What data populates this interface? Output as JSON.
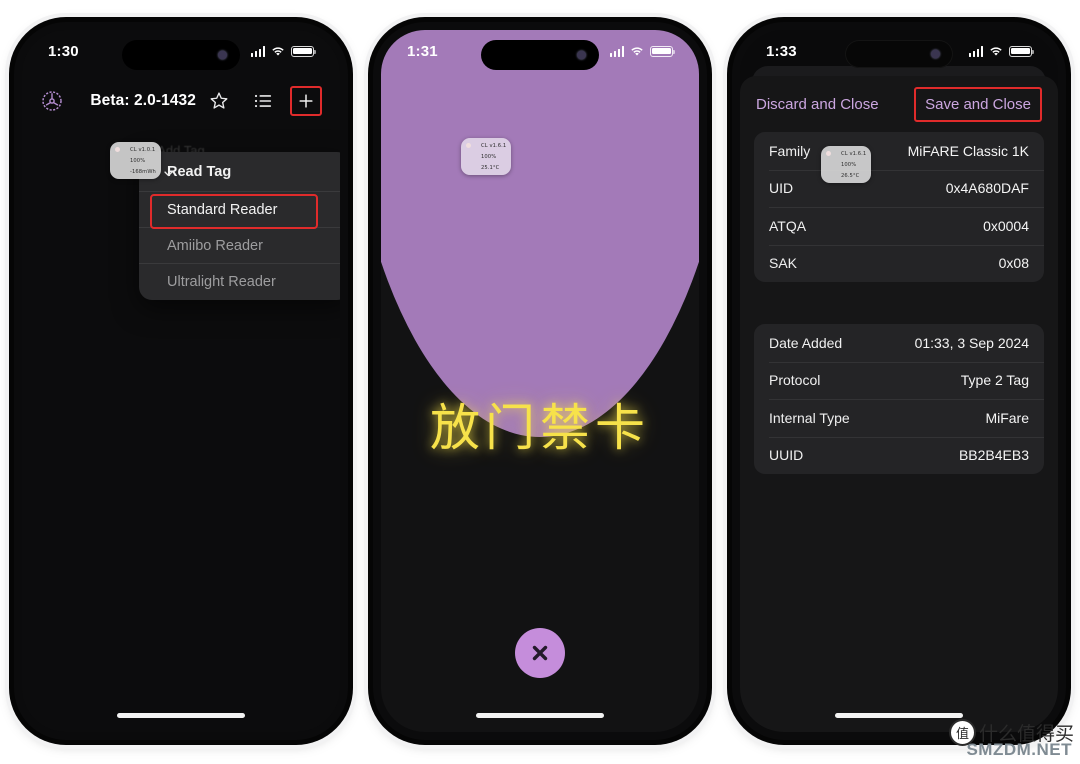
{
  "page": {
    "background": "#ffffff",
    "watermark": {
      "mark": "值",
      "brand": "什么值得买",
      "site": "SMZDM.NET"
    }
  },
  "phones": [
    {
      "id": "phone-read-tag-menu",
      "status": {
        "time": "1:30",
        "cellular": "signal-icon",
        "wifi": "wifi-icon",
        "battery": "battery-icon"
      },
      "toolbar": {
        "settings_icon": "gear-icon",
        "title": "Beta: 2.0-1432",
        "star_icon": "star-icon",
        "list_icon": "list-icon",
        "add_icon": "plus-icon",
        "add_highlighted": true
      },
      "ghost_label": "Add Tag",
      "menu": {
        "header": "Read Tag",
        "items": [
          {
            "label": "Standard Reader",
            "selected": true
          },
          {
            "label": "Amiibo Reader",
            "selected": false
          },
          {
            "label": "Ultralight Reader",
            "selected": false
          }
        ]
      },
      "widget": {
        "version": "CL v1.0.1",
        "battery": "100%",
        "third": "-168mWh",
        "third_glyph": "power-icon"
      }
    },
    {
      "id": "phone-nfc-scan",
      "status": {
        "time": "1:31",
        "cellular": "signal-icon",
        "wifi": "wifi-icon",
        "battery": "battery-icon"
      },
      "dome_color": "#a37ab8",
      "prompt": "放门禁卡",
      "prompt_color": "#f7e24a",
      "close_label": "close-icon",
      "widget": {
        "version": "CL v1.6.1",
        "battery": "100%",
        "third": "25.1°C",
        "third_glyph": "thermometer-icon"
      }
    },
    {
      "id": "phone-tag-details",
      "status": {
        "time": "1:33",
        "cellular": "signal-icon",
        "wifi": "wifi-icon",
        "battery": "battery-icon"
      },
      "actions": {
        "discard": "Discard and Close",
        "save": "Save and Close",
        "save_highlighted": true
      },
      "widget": {
        "version": "CL v1.6.1",
        "battery": "100%",
        "third": "26.5°C",
        "third_glyph": "thermometer-icon"
      },
      "groups": [
        {
          "rows": [
            {
              "key": "Family",
              "value": "MiFARE Classic 1K"
            },
            {
              "key": "UID",
              "value": "0x4A680DAF"
            },
            {
              "key": "ATQA",
              "value": "0x0004"
            },
            {
              "key": "SAK",
              "value": "0x08"
            }
          ]
        },
        {
          "rows": [
            {
              "key": "Date Added",
              "value": "01:33, 3 Sep 2024"
            },
            {
              "key": "Protocol",
              "value": "Type 2 Tag"
            },
            {
              "key": "Internal Type",
              "value": "MiFare"
            },
            {
              "key": "UUID",
              "value": "BB2B4EB3"
            }
          ]
        }
      ]
    }
  ],
  "colors": {
    "accent_purple": "#cba6e0",
    "dome_purple": "#a37ab8",
    "highlight_red": "#e02b2b",
    "prompt_yellow": "#f7e24a"
  }
}
